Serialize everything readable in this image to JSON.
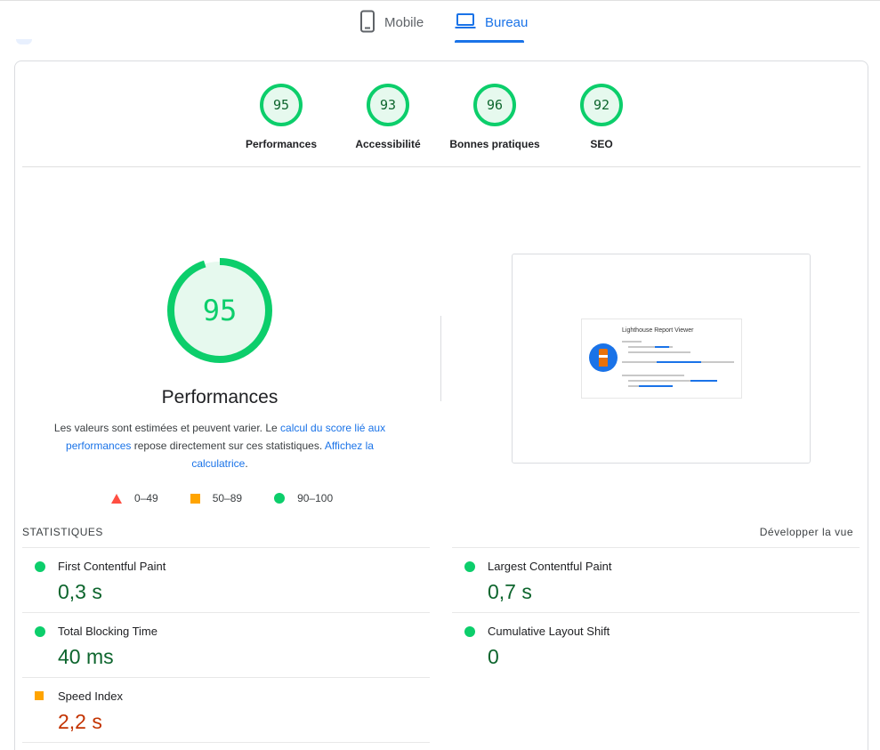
{
  "tabs": {
    "mobile_label": "Mobile",
    "desktop_label": "Bureau",
    "active": "Bureau"
  },
  "colors": {
    "pass": "#0cce6b",
    "average": "#ffa400",
    "fail": "#ff4e42",
    "link": "#1a73e8"
  },
  "summary": [
    {
      "score": "95",
      "label": "Performances"
    },
    {
      "score": "93",
      "label": "Accessibilité"
    },
    {
      "score": "96",
      "label": "Bonnes pratiques"
    },
    {
      "score": "92",
      "label": "SEO"
    }
  ],
  "performance": {
    "score": "95",
    "title": "Performances",
    "desc_1": "Les valeurs sont estimées et peuvent varier. Le ",
    "desc_link_1": "calcul du score lié aux performances",
    "desc_2": " repose directement sur ces statistiques. ",
    "desc_link_2": "Affichez la calculatrice",
    "desc_3": "."
  },
  "legend": [
    {
      "icon": "triangle-icon",
      "range": "0–49"
    },
    {
      "icon": "square-icon",
      "range": "50–89"
    },
    {
      "icon": "circle-icon",
      "range": "90–100"
    }
  ],
  "screenshot": {
    "title": "Lighthouse Report Viewer"
  },
  "stats": {
    "title": "STATISTIQUES",
    "expand_label": "Développer la vue",
    "metrics": [
      {
        "name": "First Contentful Paint",
        "value": "0,3 s",
        "status": "pass"
      },
      {
        "name": "Largest Contentful Paint",
        "value": "0,7 s",
        "status": "pass"
      },
      {
        "name": "Total Blocking Time",
        "value": "40 ms",
        "status": "pass"
      },
      {
        "name": "Cumulative Layout Shift",
        "value": "0",
        "status": "pass"
      },
      {
        "name": "Speed Index",
        "value": "2,2 s",
        "status": "average"
      }
    ]
  }
}
